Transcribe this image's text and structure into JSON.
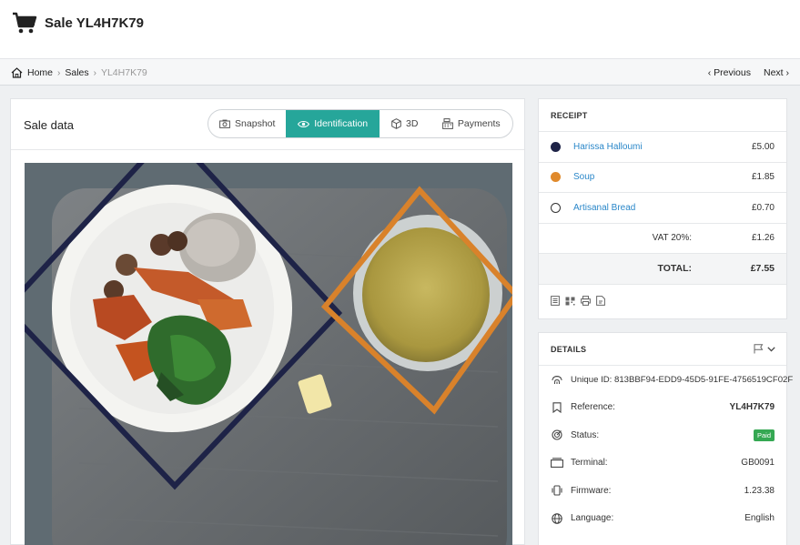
{
  "header": {
    "title": "Sale YL4H7K79",
    "icon": "shopping-cart-icon"
  },
  "breadcrumb": {
    "home": "Home",
    "sales": "Sales",
    "current": "YL4H7K79"
  },
  "pager": {
    "previous": "Previous",
    "next": "Next"
  },
  "main": {
    "title": "Sale data",
    "tabs": [
      {
        "label": "Snapshot",
        "icon": "camera-icon",
        "active": false
      },
      {
        "label": "Identification",
        "icon": "eye-icon",
        "active": true
      },
      {
        "label": "3D",
        "icon": "cube-icon",
        "active": false
      },
      {
        "label": "Payments",
        "icon": "cash-register-icon",
        "active": false
      }
    ],
    "accent": "#26a69a",
    "overlay_colors": {
      "halloumi": "#1e2347",
      "soup": "#d9822b"
    }
  },
  "receipt": {
    "heading": "RECEIPT",
    "items": [
      {
        "name": "Harissa Halloumi",
        "price": "£5.00",
        "color": "#1e2347"
      },
      {
        "name": "Soup",
        "price": "£1.85",
        "color": "#e08a2c"
      },
      {
        "name": "Artisanal Bread",
        "price": "£0.70",
        "color": "none"
      }
    ],
    "vat_label": "VAT 20%:",
    "vat_value": "£1.26",
    "total_label": "TOTAL:",
    "total_value": "£7.55",
    "actions": [
      "list-icon",
      "qr-icon",
      "print-icon",
      "pdf-icon"
    ]
  },
  "details": {
    "heading": "DETAILS",
    "unique_id": "Unique ID: 813BBF94-EDD9-45D5-91FE-4756519CF02F",
    "reference_label": "Reference:",
    "reference_value": "YL4H7K79",
    "status_label": "Status:",
    "status_value": "Paid",
    "status_color": "#35a853",
    "terminal_label": "Terminal:",
    "terminal_value": "GB0091",
    "firmware_label": "Firmware:",
    "firmware_value": "1.23.38",
    "language_label": "Language:",
    "language_value": "English"
  }
}
